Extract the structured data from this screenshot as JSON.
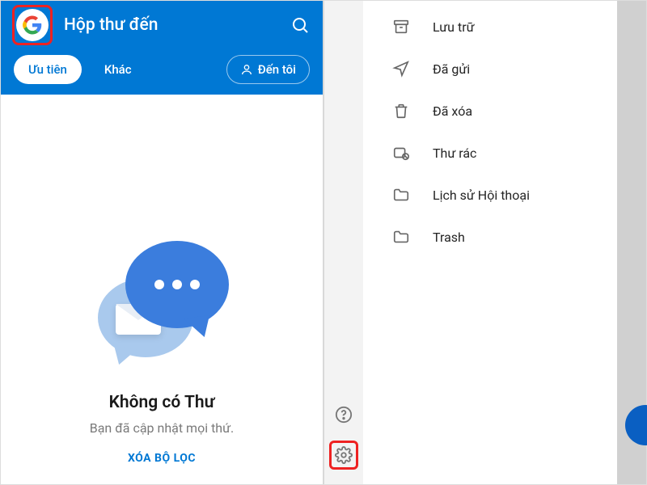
{
  "header": {
    "title": "Hộp thư đến",
    "account_icon": "google-logo",
    "search_icon": "search"
  },
  "tabs": {
    "primary": "Ưu tiên",
    "other": "Khác",
    "filter_label": "Đến tôi"
  },
  "empty_state": {
    "title": "Không có Thư",
    "subtitle": "Bạn đã cập nhật mọi thứ.",
    "clear_filter": "XÓA BỘ LỌC"
  },
  "menu": {
    "items": [
      {
        "icon": "archive",
        "label": "Lưu trữ"
      },
      {
        "icon": "sent",
        "label": "Đã gửi"
      },
      {
        "icon": "trash",
        "label": "Đã xóa"
      },
      {
        "icon": "spam",
        "label": "Thư rác"
      },
      {
        "icon": "folder",
        "label": "Lịch sử Hội thoại"
      },
      {
        "icon": "folder",
        "label": "Trash"
      }
    ]
  },
  "rail": {
    "help": "help",
    "settings": "settings"
  }
}
